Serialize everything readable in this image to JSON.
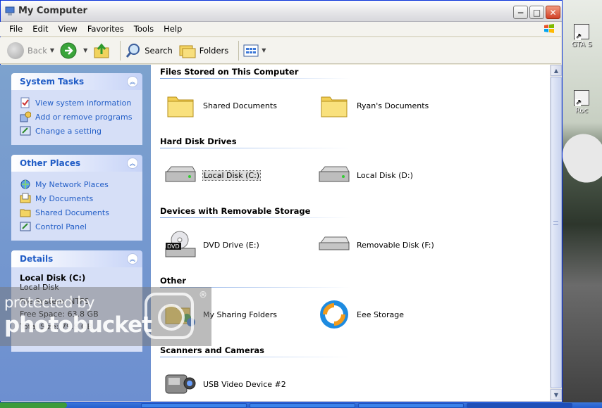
{
  "window": {
    "title": "My Computer",
    "buttons": {
      "minimize": "−",
      "maximize": "□",
      "close": "✕"
    }
  },
  "menu": [
    "File",
    "Edit",
    "View",
    "Favorites",
    "Tools",
    "Help"
  ],
  "toolbar": {
    "back": "Back",
    "search": "Search",
    "folders": "Folders"
  },
  "sidebar": {
    "system_tasks": {
      "title": "System Tasks",
      "items": [
        "View system information",
        "Add or remove programs",
        "Change a setting"
      ]
    },
    "other_places": {
      "title": "Other Places",
      "items": [
        "My Network Places",
        "My Documents",
        "Shared Documents",
        "Control Panel"
      ]
    },
    "details": {
      "title": "Details",
      "name": "Local Disk (C:)",
      "type": "Local Disk",
      "file_system": "File System: NTFS",
      "free_space": "Free Space: 63.8 GB",
      "total_size": "Total Size: 79.9 GB"
    }
  },
  "groups": [
    {
      "title": "Files Stored on This Computer",
      "items": [
        "Shared Documents",
        "Ryan's Documents"
      ]
    },
    {
      "title": "Hard Disk Drives",
      "items": [
        "Local Disk (C:)",
        "Local Disk (D:)"
      ]
    },
    {
      "title": "Devices with Removable Storage",
      "items": [
        "DVD Drive (E:)",
        "Removable Disk (F:)"
      ]
    },
    {
      "title": "Other",
      "items": [
        "My Sharing Folders",
        "Eee Storage"
      ]
    },
    {
      "title": "Scanners and Cameras",
      "items": [
        "USB Video Device #2"
      ]
    }
  ],
  "desktop": {
    "icons": [
      "GTA S",
      "Roc"
    ]
  },
  "watermark": {
    "line1": "protected by",
    "line2": "photobucket",
    "mark": "®"
  },
  "colors": {
    "task_link": "#215dc6",
    "sidebar_bg": "#7da2ce",
    "selection": "#dcdcdc"
  }
}
